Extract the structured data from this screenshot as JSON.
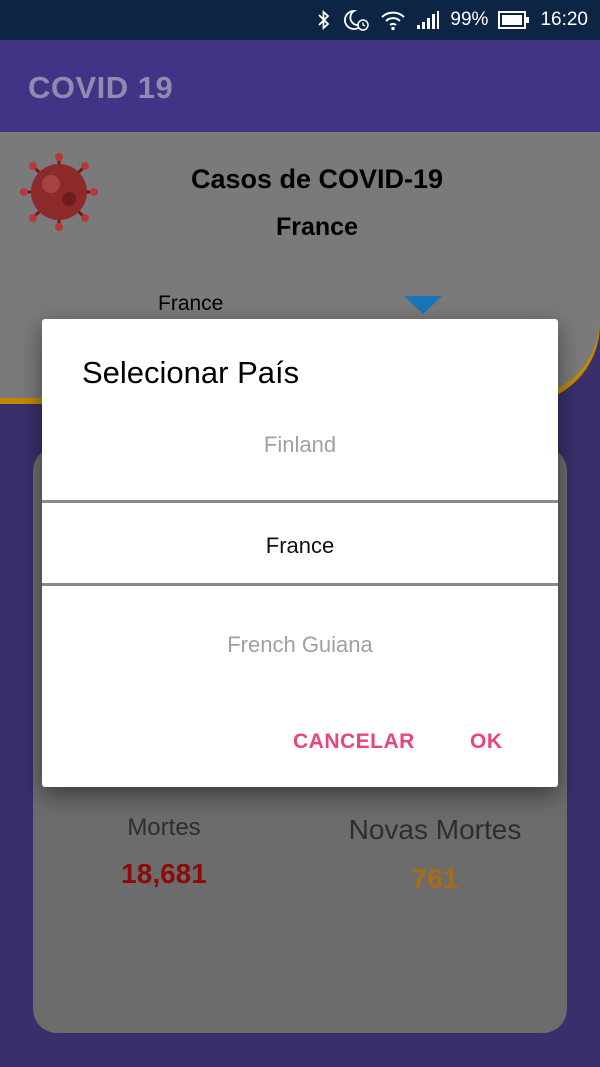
{
  "status_bar": {
    "battery": "99%",
    "time": "16:20",
    "icons": [
      "bluetooth-icon",
      "night-mode-icon",
      "wifi-icon",
      "signal-icon",
      "battery-icon"
    ]
  },
  "app_bar": {
    "title": "COVID 19"
  },
  "header": {
    "title": "Casos de COVID-19",
    "country": "France",
    "spinner_value": "France",
    "accent_color": "#c08a00"
  },
  "stats": {
    "deaths_label": "Mortes",
    "deaths_value": "18,681",
    "new_deaths_label": "Novas Mortes",
    "new_deaths_value": "761",
    "deaths_color": "#8b0a0a",
    "new_deaths_color": "#a66d12"
  },
  "dialog": {
    "title": "Selecionar País",
    "options": [
      "Finland",
      "France",
      "French Guiana"
    ],
    "selected": "France",
    "cancel_label": "CANCELAR",
    "ok_label": "OK",
    "button_color": "#e8457c"
  }
}
